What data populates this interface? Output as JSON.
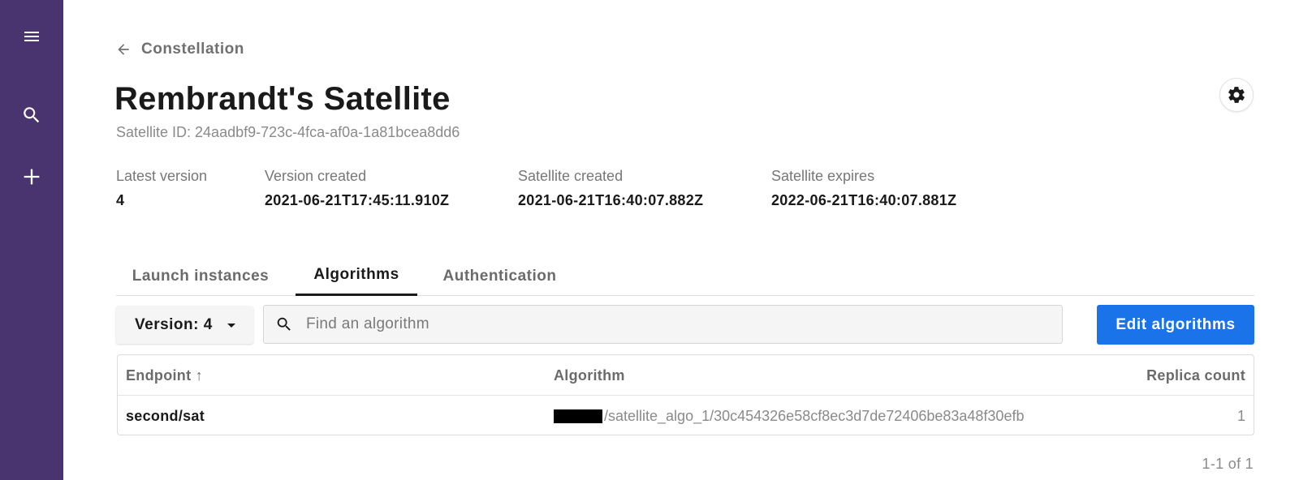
{
  "breadcrumb": {
    "back_label": "Constellation"
  },
  "header": {
    "title": "Rembrandt's Satellite",
    "satellite_id": "Satellite ID: 24aadbf9-723c-4fca-af0a-1a81bcea8dd6"
  },
  "meta": [
    {
      "label": "Latest version",
      "value": "4"
    },
    {
      "label": "Version created",
      "value": "2021-06-21T17:45:11.910Z"
    },
    {
      "label": "Satellite created",
      "value": "2021-06-21T16:40:07.882Z"
    },
    {
      "label": "Satellite expires",
      "value": "2022-06-21T16:40:07.881Z"
    }
  ],
  "tabs": [
    {
      "label": "Launch instances",
      "active": false
    },
    {
      "label": "Algorithms",
      "active": true
    },
    {
      "label": "Authentication",
      "active": false
    }
  ],
  "toolbar": {
    "version_label": "Version: 4",
    "search_placeholder": "Find an algorithm",
    "search_value": "",
    "edit_label": "Edit algorithms"
  },
  "table": {
    "headers": {
      "endpoint": "Endpoint",
      "sort_indicator": "↑",
      "algorithm": "Algorithm",
      "replica": "Replica count"
    },
    "rows": [
      {
        "endpoint": "second/sat",
        "algorithm": "/satellite_algo_1/30c454326e58cf8ec3d7de72406be83a48f30efb",
        "replica": "1"
      }
    ]
  },
  "pagination": "1-1 of 1",
  "icons": {
    "sidebar": [
      "menu-icon",
      "search-icon",
      "plus-icon"
    ],
    "back": "arrow-left-icon",
    "settings": "gear-icon",
    "dropdown": "caret-down-icon"
  },
  "colors": {
    "sidebar": "#4a3470",
    "primary": "#1a73e8",
    "text": "#1a1a1a",
    "muted": "#8a8a8a"
  }
}
